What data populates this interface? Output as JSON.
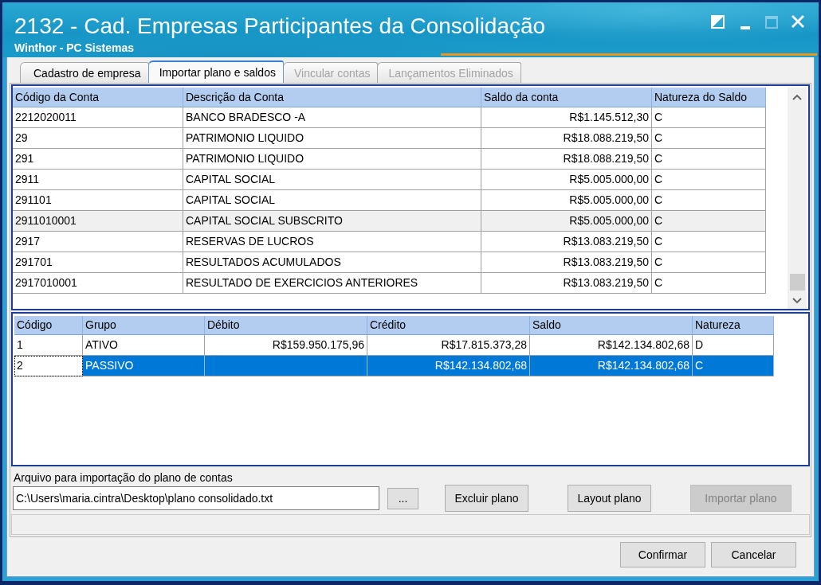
{
  "window": {
    "title": "2132 - Cad. Empresas Participantes da Consolidação",
    "subtitle": "Winthor - PC Sistemas",
    "controls": [
      {
        "kind": "snap",
        "disabled": false
      },
      {
        "kind": "minimize",
        "disabled": false
      },
      {
        "kind": "maximize",
        "disabled": true
      },
      {
        "kind": "close",
        "disabled": false
      }
    ]
  },
  "tabs": [
    {
      "label": "Cadastro de empresa",
      "selected": false,
      "disabled": false
    },
    {
      "label": "Importar plano e saldos",
      "selected": true,
      "disabled": false
    },
    {
      "label": "Vincular contas",
      "selected": false,
      "disabled": true
    },
    {
      "label": "Lançamentos Eliminados",
      "selected": false,
      "disabled": true
    }
  ],
  "accounts_table": {
    "focused": false,
    "columns": [
      {
        "label": "Código da Conta",
        "kind": "text"
      },
      {
        "label": "Descrição da Conta",
        "kind": "text"
      },
      {
        "label": "Saldo da conta",
        "kind": "money"
      },
      {
        "label": "Natureza do Saldo",
        "kind": "text"
      }
    ],
    "rows": [
      {
        "cells": [
          "2212020011",
          "BANCO BRADESCO -A",
          "R$1.145.512,30",
          "C"
        ],
        "selected": false
      },
      {
        "cells": [
          "29",
          "PATRIMONIO LIQUIDO",
          "R$18.088.219,50",
          "C"
        ],
        "selected": false
      },
      {
        "cells": [
          "291",
          "PATRIMONIO LIQUIDO",
          "R$18.088.219,50",
          "C"
        ],
        "selected": false
      },
      {
        "cells": [
          "2911",
          "CAPITAL SOCIAL",
          "R$5.005.000,00",
          "C"
        ],
        "selected": false
      },
      {
        "cells": [
          "291101",
          "CAPITAL SOCIAL",
          "R$5.005.000,00",
          "C"
        ],
        "selected": false
      },
      {
        "cells": [
          "2911010001",
          "CAPITAL SOCIAL SUBSCRITO",
          "R$5.005.000,00",
          "C"
        ],
        "selected": true
      },
      {
        "cells": [
          "2917",
          "RESERVAS DE LUCROS",
          "R$13.083.219,50",
          "C"
        ],
        "selected": false
      },
      {
        "cells": [
          "291701",
          "RESULTADOS ACUMULADOS",
          "R$13.083.219,50",
          "C"
        ],
        "selected": false
      },
      {
        "cells": [
          "2917010001",
          "RESULTADO DE EXERCICIOS ANTERIORES",
          "R$13.083.219,50",
          "C"
        ],
        "selected": false
      }
    ]
  },
  "groups_table": {
    "focused": true,
    "columns": [
      {
        "label": "Código",
        "kind": "text"
      },
      {
        "label": "Grupo",
        "kind": "text"
      },
      {
        "label": "Débito",
        "kind": "money"
      },
      {
        "label": "Crédito",
        "kind": "money"
      },
      {
        "label": "Saldo",
        "kind": "money"
      },
      {
        "label": "Natureza",
        "kind": "text"
      }
    ],
    "rows": [
      {
        "cells": [
          "1",
          "ATIVO",
          "R$159.950.175,96",
          "R$17.815.373,28",
          "R$142.134.802,68",
          "D"
        ],
        "selected": false,
        "focused": false
      },
      {
        "cells": [
          "2",
          "PASSIVO",
          null,
          "R$142.134.802,68",
          "R$142.134.802,68",
          "C"
        ],
        "selected": true,
        "focused": true
      }
    ]
  },
  "import_file": {
    "label": "Arquivo para importação do plano de contas",
    "value": "C:\\Users\\maria.cintra\\Desktop\\plano consolidado.txt"
  },
  "file_buttons": [
    {
      "label": "...",
      "disabled": false
    },
    {
      "label": "Excluir plano",
      "disabled": false
    },
    {
      "label": "Layout plano",
      "disabled": false
    },
    {
      "label": "Importar plano",
      "disabled": true
    }
  ],
  "dialog_buttons": [
    {
      "label": "Confirmar"
    },
    {
      "label": "Cancelar"
    }
  ]
}
